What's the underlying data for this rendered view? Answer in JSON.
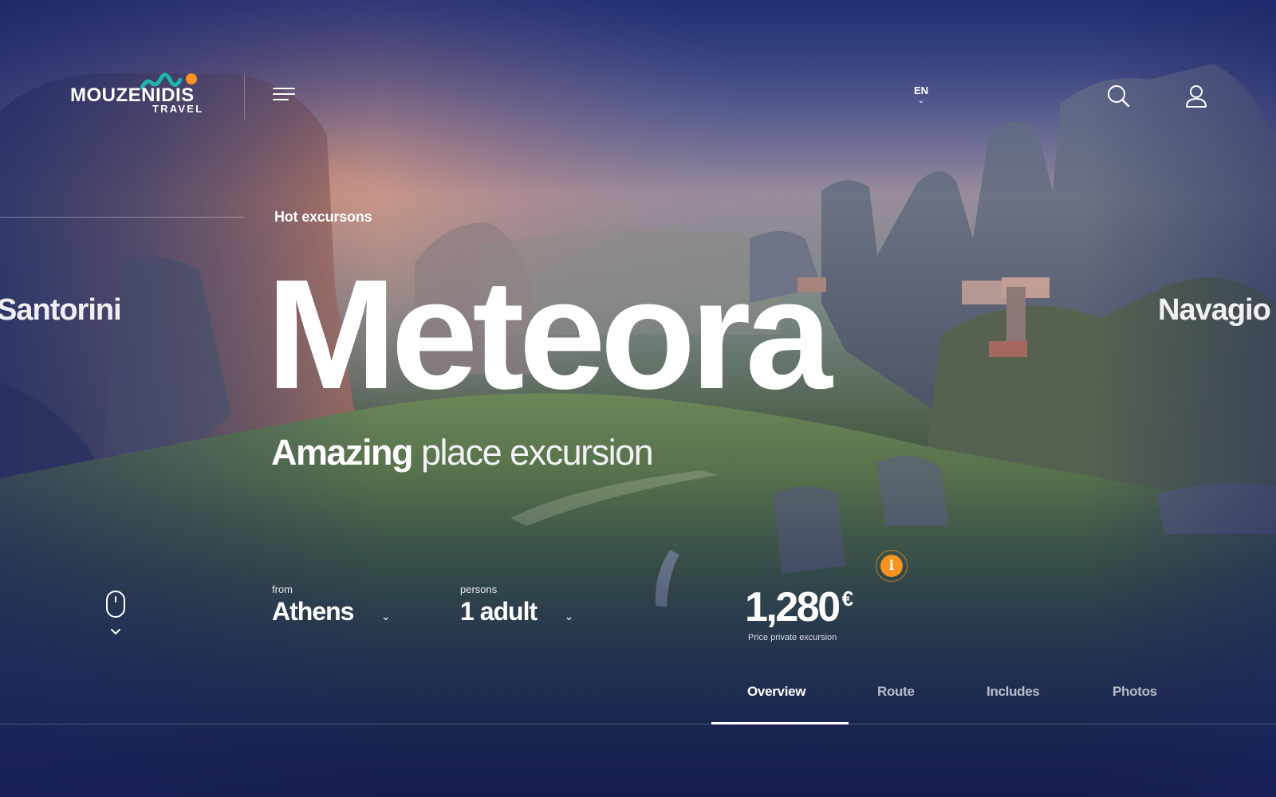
{
  "brand": {
    "name": "MOUZENIDIS",
    "sub": "TRAVEL",
    "accent_teal": "#1fb5ad",
    "accent_orange": "#f7931e"
  },
  "header": {
    "menu_icon": "hamburger-menu-icon",
    "language": "EN",
    "search_icon": "search-icon",
    "user_icon": "user-icon"
  },
  "hero": {
    "eyebrow": "Hot excursons",
    "title": "Meteora",
    "subtitle_bold": "Amazing",
    "subtitle_light": "place excursion",
    "prev_destination": "Santorini",
    "next_destination": "Navagio"
  },
  "booking": {
    "from_label": "from",
    "from_value": "Athens",
    "persons_label": "persons",
    "persons_value": "1 adult",
    "price": "1,280",
    "currency": "€",
    "price_note": "Price private excursion",
    "info_icon": "i"
  },
  "tabs": [
    {
      "label": "Overview",
      "active": true
    },
    {
      "label": "Route",
      "active": false
    },
    {
      "label": "Includes",
      "active": false
    },
    {
      "label": "Photos",
      "active": false
    }
  ],
  "scroll_icon": "mouse-scroll-icon"
}
